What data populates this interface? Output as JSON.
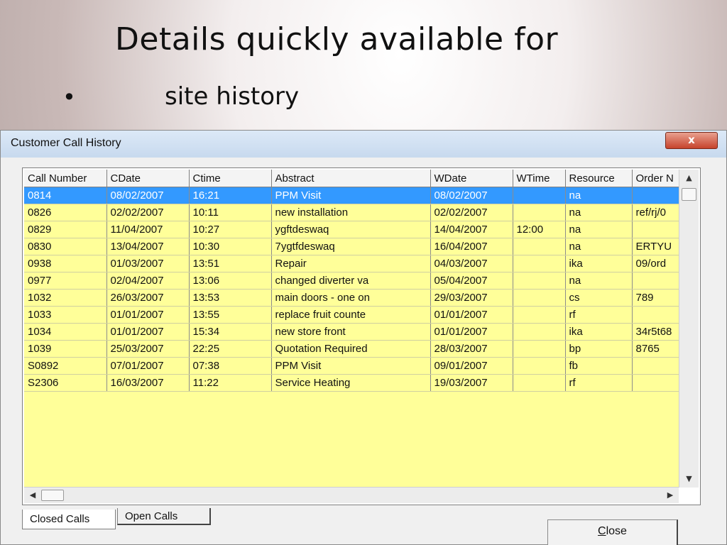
{
  "slide": {
    "title": "Details quickly available for",
    "bullet": "•",
    "bullet_text": "site history"
  },
  "window": {
    "title": "Customer Call History",
    "close_glyph": "x"
  },
  "grid": {
    "columns": [
      "Call Number",
      "CDate",
      "Ctime",
      "Abstract",
      "WDate",
      "WTime",
      "Resource",
      "Order N"
    ],
    "rows": [
      [
        "0814",
        "08/02/2007",
        "16:21",
        "PPM Visit",
        "08/02/2007",
        "",
        "na",
        ""
      ],
      [
        "0826",
        "02/02/2007",
        "10:11",
        "new installation",
        "02/02/2007",
        "",
        "na",
        "ref/rj/0"
      ],
      [
        "0829",
        "11/04/2007",
        "10:27",
        "ygftdeswaq",
        "14/04/2007",
        "12:00",
        "na",
        ""
      ],
      [
        "0830",
        "13/04/2007",
        "10:30",
        "7ygtfdeswaq",
        "16/04/2007",
        "",
        "na",
        "ERTYU"
      ],
      [
        "0938",
        "01/03/2007",
        "13:51",
        "Repair",
        "04/03/2007",
        "",
        "ika",
        "09/ord"
      ],
      [
        "0977",
        "02/04/2007",
        "13:06",
        "changed diverter va",
        "05/04/2007",
        "",
        "na",
        ""
      ],
      [
        "1032",
        "26/03/2007",
        "13:53",
        "main doors - one on",
        "29/03/2007",
        "",
        "cs",
        "789"
      ],
      [
        "1033",
        "01/01/2007",
        "13:55",
        "replace fruit counte",
        "01/01/2007",
        "",
        "rf",
        ""
      ],
      [
        "1034",
        "01/01/2007",
        "15:34",
        "new store front",
        "01/01/2007",
        "",
        "ika",
        "34r5t68"
      ],
      [
        "1039",
        "25/03/2007",
        "22:25",
        "Quotation Required",
        "28/03/2007",
        "",
        "bp",
        "8765"
      ],
      [
        "S0892",
        "07/01/2007",
        "07:38",
        "PPM Visit",
        "09/01/2007",
        "",
        "fb",
        ""
      ],
      [
        "S2306",
        "16/03/2007",
        "11:22",
        "Service Heating",
        "19/03/2007",
        "",
        "rf",
        ""
      ]
    ],
    "selected_row": 0
  },
  "tabs": [
    {
      "label": "Closed Calls",
      "active": true
    },
    {
      "label": "Open Calls",
      "active": false
    }
  ],
  "buttons": {
    "close_accel": "C",
    "close_rest": "lose"
  },
  "colors": {
    "grid_background": "#ffff99",
    "selection": "#3399ff"
  }
}
